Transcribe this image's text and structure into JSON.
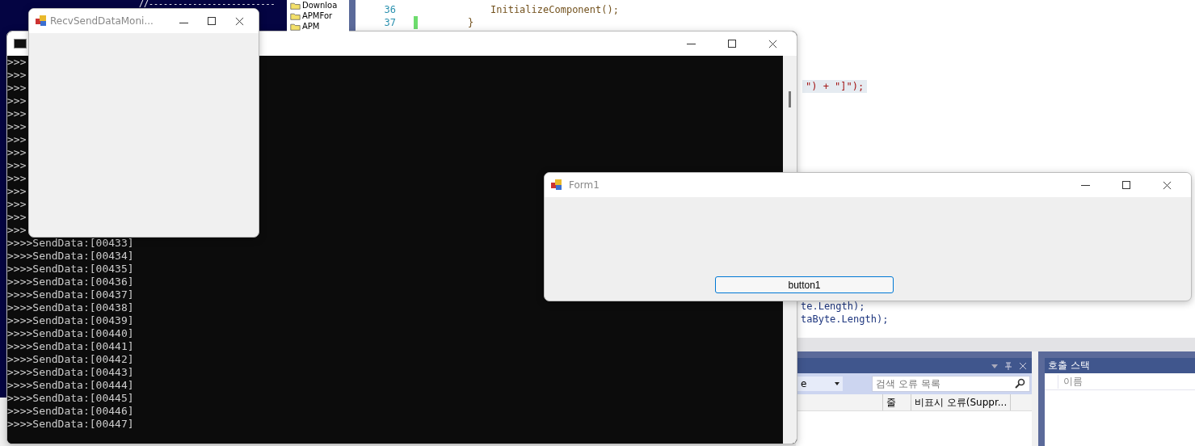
{
  "editor": {
    "tree_items": [
      {
        "label": "Downloa"
      },
      {
        "label": "APMFor"
      },
      {
        "label": "APM"
      }
    ],
    "comment": "//--------------------------",
    "lines": [
      {
        "number": "36",
        "code": "InitializeComponent();",
        "changed": false
      },
      {
        "number": "37",
        "code": "}",
        "changed": true
      }
    ],
    "fragments": [
      {
        "text": "\") + \"]\");",
        "highlighted": true
      },
      {
        "text": "te.Length);",
        "highlighted": false
      },
      {
        "text": "taByte.Length);",
        "highlighted": false
      }
    ]
  },
  "error_list": {
    "filter": "e",
    "search": {
      "placeholder": "검색 오류 목록"
    },
    "columns": [
      "줄",
      "비표시 오류(Suppr..."
    ]
  },
  "call_stack": {
    "title": "호출 스택",
    "columns": [
      "이름"
    ]
  },
  "console": {
    "covered_lines": [
      ">>>",
      ">>>",
      ">>>",
      ">>>",
      ">>>",
      ">>>",
      ">>>",
      ">>>",
      ">>>",
      ">>>",
      ">>>",
      ">>>",
      ">>>",
      ">>>"
    ],
    "lines": [
      ">>>>SendData:[00433]",
      ">>>>SendData:[00434]",
      ">>>>SendData:[00435]",
      ">>>>SendData:[00436]",
      ">>>>SendData:[00437]",
      ">>>>SendData:[00438]",
      ">>>>SendData:[00439]",
      ">>>>SendData:[00440]",
      ">>>>SendData:[00441]",
      ">>>>SendData:[00442]",
      ">>>>SendData:[00443]",
      ">>>>SendData:[00444]",
      ">>>>SendData:[00445]",
      ">>>>SendData:[00446]",
      ">>>>SendData:[00447]"
    ]
  },
  "recv_window": {
    "title": "RecvSendDataMoni..."
  },
  "form1": {
    "title": "Form1",
    "button": "button1"
  }
}
